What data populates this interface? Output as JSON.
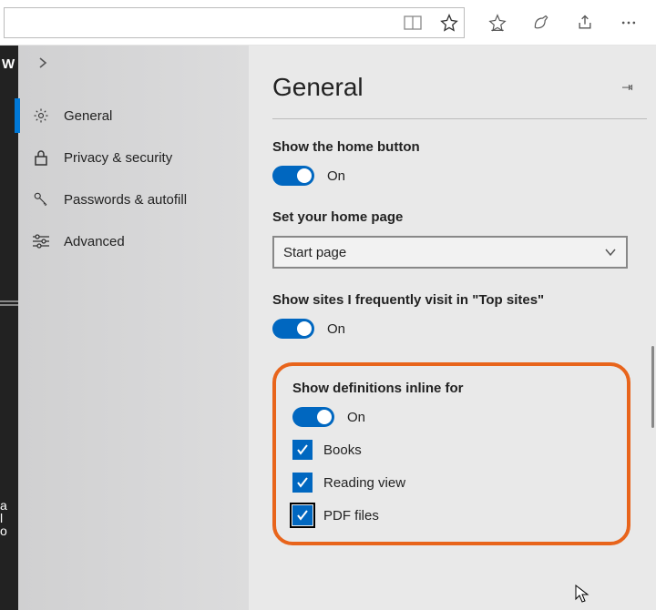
{
  "sidebar": {
    "items": [
      {
        "label": "General"
      },
      {
        "label": "Privacy & security"
      },
      {
        "label": "Passwords & autofill"
      },
      {
        "label": "Advanced"
      }
    ]
  },
  "panel": {
    "title": "General",
    "showHomeButton": {
      "label": "Show the home button",
      "state": "On"
    },
    "homePage": {
      "label": "Set your home page",
      "value": "Start page"
    },
    "topSites": {
      "label": "Show sites I frequently visit in \"Top sites\"",
      "state": "On"
    },
    "definitions": {
      "label": "Show definitions inline for",
      "state": "On",
      "options": [
        {
          "label": "Books"
        },
        {
          "label": "Reading view"
        },
        {
          "label": "PDF files"
        }
      ]
    }
  }
}
